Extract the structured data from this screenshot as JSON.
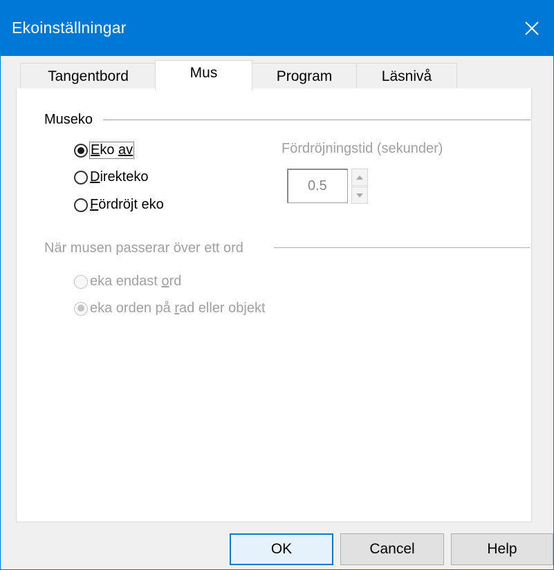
{
  "window": {
    "title": "Ekoinställningar",
    "close_icon": "close-icon",
    "accent": "#0078d7"
  },
  "tabs": [
    {
      "label": "Tangentbord",
      "active": false
    },
    {
      "label": "Mus",
      "active": true
    },
    {
      "label": "Program",
      "active": false
    },
    {
      "label": "Läsnivå",
      "active": false
    }
  ],
  "museko": {
    "label": "Museko",
    "options": [
      {
        "prefix": "",
        "mnemonic": "E",
        "rest": "ko ",
        "mnemonic2": "",
        "rest_u": "av",
        "checked": true
      },
      {
        "mnemonic": "D",
        "rest": "irekteko",
        "checked": false
      },
      {
        "mnemonic": "F",
        "rest": "ördröjt eko",
        "checked": false
      }
    ],
    "delay": {
      "label": "Fördröjningstid (sekunder)",
      "value": "0.5"
    }
  },
  "hover": {
    "label": "När musen passerar över ett ord",
    "options": [
      {
        "before": "eka endast ",
        "mnemonic": "o",
        "after": "rd",
        "checked": false
      },
      {
        "before": "eka orden på ",
        "mnemonic": "r",
        "after": "ad eller objekt",
        "checked": true
      }
    ]
  },
  "buttons": {
    "ok": "OK",
    "cancel": "Cancel",
    "help": "Help"
  }
}
